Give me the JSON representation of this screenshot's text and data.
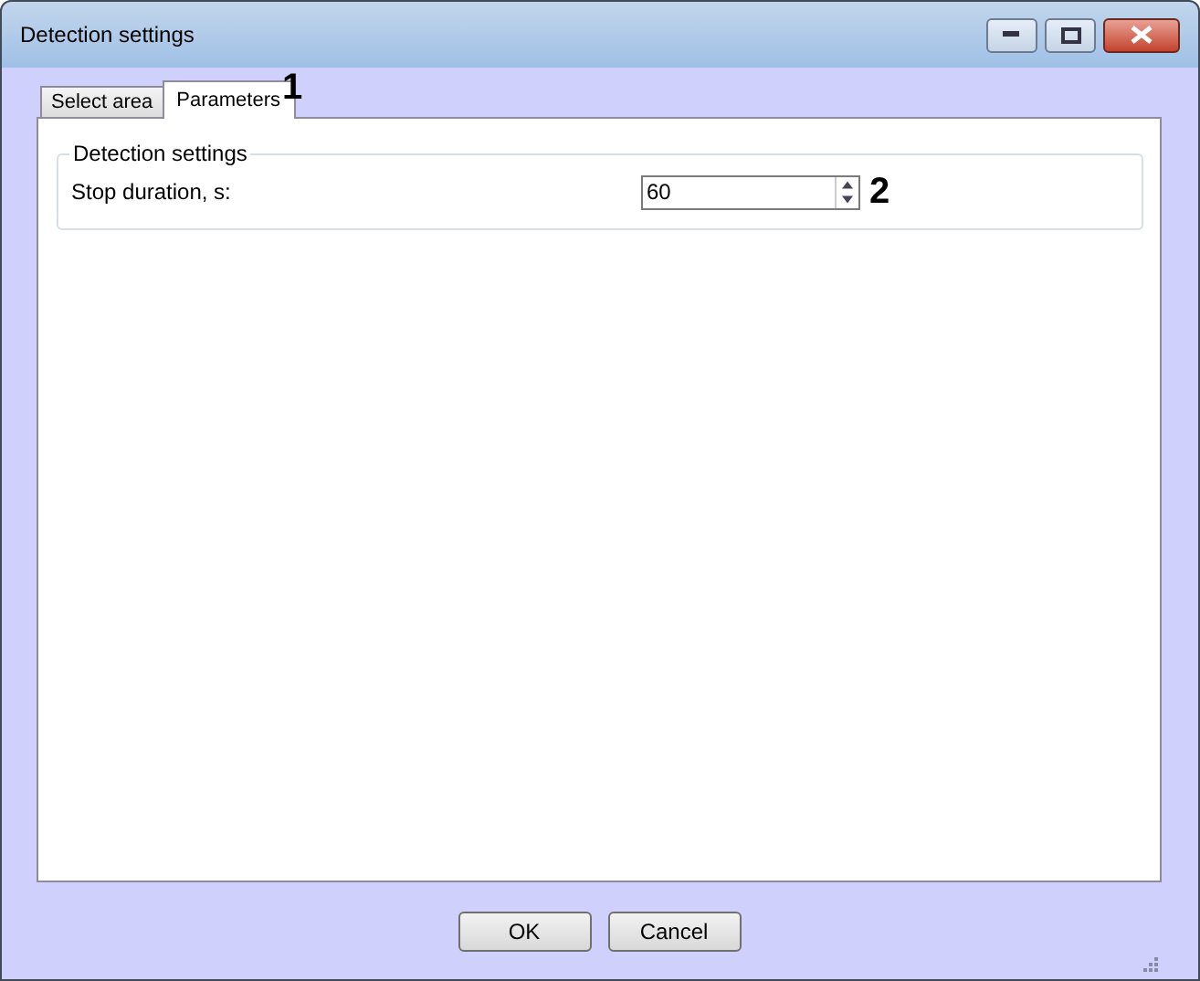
{
  "window": {
    "title": "Detection settings"
  },
  "tabs": [
    {
      "label": "Select area",
      "selected": false
    },
    {
      "label": "Parameters",
      "selected": true
    }
  ],
  "callouts": [
    {
      "text": "1",
      "kind": "tab"
    },
    {
      "text": "2",
      "kind": "field"
    }
  ],
  "group": {
    "title": "Detection settings",
    "fields": [
      {
        "label": "Stop duration, s:",
        "value": "60"
      }
    ]
  },
  "buttons": [
    "OK",
    "Cancel"
  ]
}
